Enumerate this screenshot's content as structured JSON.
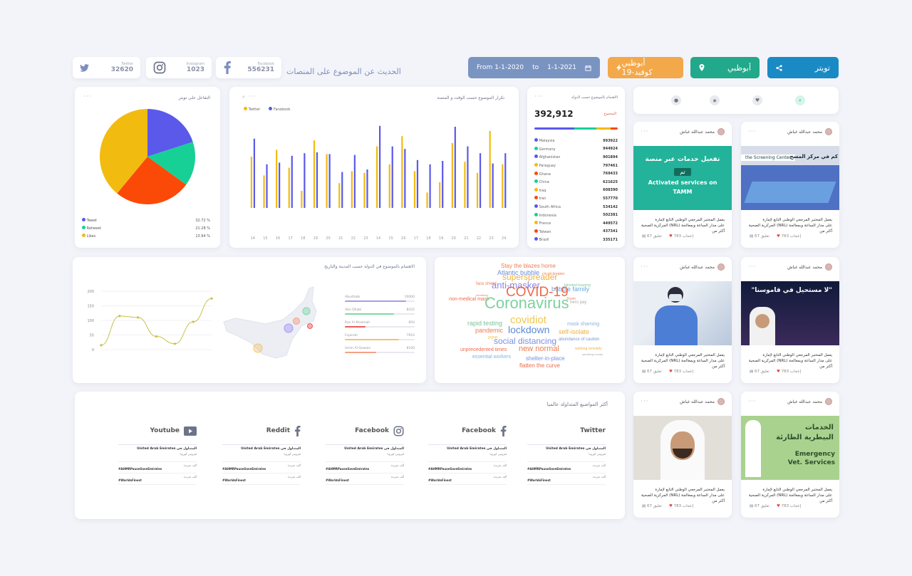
{
  "header": {
    "title": "الحديث عن الموضوع على المنصات",
    "stats": [
      {
        "label": "Twitter",
        "value": "32620",
        "icon": "twitter-icon"
      },
      {
        "label": "Instagram",
        "value": "1023",
        "icon": "instagram-icon"
      },
      {
        "label": "Facebook",
        "value": "556231",
        "icon": "facebook-icon"
      }
    ],
    "filters": {
      "from_label": "From",
      "from_date": "1-1-2020",
      "to_label": "to",
      "to_date": "1-1-2021",
      "topic": "أبوظبي كوفيد-19",
      "location": "أبوظبي",
      "platform": "تويتر"
    }
  },
  "colors": {
    "date_pill": "#7a94c2",
    "topic_pill": "#f3a84a",
    "location_pill": "#22a88a",
    "platform_pill": "#1a8ac5",
    "blue": "#5a59ea",
    "yellow": "#f2bb10",
    "green": "#17d096",
    "orange": "#fb4a08"
  },
  "pie_card": {
    "title": "التفاعل على تويتر",
    "legend": [
      {
        "label": "Tweet",
        "value": "32.72 %",
        "color": "#5a59ea"
      },
      {
        "label": "Retweet",
        "value": "21.28 %",
        "color": "#17d096"
      },
      {
        "label": "Likes",
        "value": "13.94 %",
        "color": "#f2bb10"
      }
    ]
  },
  "bar_card": {
    "title": "تكرار الموضوع حسب الوقت و المنصة",
    "legend": [
      {
        "label": "Twitter",
        "color": "#f2bb10"
      },
      {
        "label": "Facebook",
        "color": "#5a59ea"
      }
    ]
  },
  "country_card": {
    "title": "الاهتمام بالموضوع حسب الدولة",
    "total": "392,912",
    "total_label": "المجموع",
    "countries": [
      {
        "name": "Malaysia",
        "value": "993922",
        "color": "#5a59ea"
      },
      {
        "name": "Germany",
        "value": "944924",
        "color": "#17d096"
      },
      {
        "name": "Afghanistan",
        "value": "901894",
        "color": "#5a59ea"
      },
      {
        "name": "Paraguay",
        "value": "797461",
        "color": "#f2bb10"
      },
      {
        "name": "Ghana",
        "value": "769433",
        "color": "#fb4a08"
      },
      {
        "name": "China",
        "value": "621625",
        "color": "#17d096"
      },
      {
        "name": "Iraq",
        "value": "608390",
        "color": "#f2bb10"
      },
      {
        "name": "Iran",
        "value": "557770",
        "color": "#fb4a08"
      },
      {
        "name": "South Africa",
        "value": "534142",
        "color": "#5a59ea"
      },
      {
        "name": "Indonesia",
        "value": "502381",
        "color": "#17d096"
      },
      {
        "name": "France",
        "value": "449572",
        "color": "#f2bb10"
      },
      {
        "name": "Taiwan",
        "value": "437341",
        "color": "#fb4a08"
      },
      {
        "name": "Brazil",
        "value": "335171",
        "color": "#5a59ea"
      }
    ]
  },
  "map_card": {
    "title": "الاهتمام بالموضوع في الدولة حسب المدينة والتاريخ",
    "cities": [
      {
        "name": "Abudhabi",
        "value": "10000",
        "color": "#a59ef0",
        "fraction": 0.88
      },
      {
        "name": "Abu Dhabi",
        "value": "8432",
        "color": "#7fd9a6",
        "fraction": 0.7
      },
      {
        "name": "Ras Al Khaimah",
        "value": "850",
        "color": "#ee5a5a",
        "fraction": 0.3
      },
      {
        "name": "Fujairah",
        "value": "7910",
        "color": "#f3c46b",
        "fraction": 0.78
      },
      {
        "name": "Umm Al Quwain",
        "value": "8100",
        "color": "#f3a185",
        "fraction": 0.45
      }
    ]
  },
  "chart_data": [
    {
      "type": "pie",
      "labels": [
        "Tweet",
        "Retweet",
        "Likes"
      ],
      "values": [
        20,
        15,
        26,
        39
      ],
      "slice_colors": [
        "#5a59ea",
        "#17d096",
        "#fb4a08",
        "#f2bb10"
      ]
    },
    {
      "type": "bar",
      "categories": [
        "14",
        "15",
        "16",
        "17",
        "18",
        "19",
        "20",
        "21",
        "22",
        "23",
        "14",
        "15",
        "16",
        "17",
        "18",
        "19",
        "20",
        "21",
        "22",
        "23",
        "24"
      ],
      "series": [
        {
          "name": "Twitter",
          "values": [
            60,
            38,
            68,
            47,
            20,
            79,
            63,
            29,
            43,
            41,
            72,
            51,
            84,
            43,
            18,
            30,
            76,
            54,
            41,
            90,
            51
          ]
        },
        {
          "name": "Facebook",
          "values": [
            81,
            51,
            53,
            61,
            64,
            65,
            63,
            42,
            62,
            45,
            96,
            72,
            69,
            56,
            51,
            55,
            95,
            72,
            64,
            52,
            64
          ]
        }
      ],
      "ylim": [
        0,
        100
      ]
    },
    {
      "type": "line",
      "y_ticks": [
        0,
        50,
        100,
        150,
        200
      ],
      "values": [
        15,
        115,
        110,
        45,
        20,
        95,
        175
      ],
      "ylim": [
        0,
        200
      ]
    }
  ],
  "wordcloud": [
    {
      "text": "Stay the blazes home",
      "size": 8,
      "color": "#ef7d50"
    },
    {
      "text": "Atlantic bubble",
      "size": 9,
      "color": "#6a8fd9"
    },
    {
      "text": "circuit breaker",
      "size": 5,
      "color": "#ef7d50"
    },
    {
      "text": "face shield",
      "size": 6,
      "color": "#ef7d50"
    },
    {
      "text": "superspreader",
      "size": 12,
      "color": "#f2b138"
    },
    {
      "text": "blended learning",
      "size": 5,
      "color": "#7ac7a3"
    },
    {
      "text": "Infodemic",
      "size": 4,
      "color": "#ef7d50"
    },
    {
      "text": "anti-masker",
      "size": 13,
      "color": "#8a86e4"
    },
    {
      "text": "bubble family",
      "size": 9,
      "color": "#6aa7e0"
    },
    {
      "text": "Zoom",
      "size": 5,
      "color": "#ef7d50"
    },
    {
      "text": "hero pay",
      "size": 6,
      "color": "#aaa"
    },
    {
      "text": "non-medical mask",
      "size": 7,
      "color": "#ef6a4a"
    },
    {
      "text": "COVID-19",
      "size": 19,
      "color": "#ef6a4a"
    },
    {
      "text": "Coronavirus",
      "size": 22,
      "color": "#7fd0a0"
    },
    {
      "text": "rapid testing",
      "size": 9,
      "color": "#79c39a"
    },
    {
      "text": "covidiot",
      "size": 15,
      "color": "#f2c84a"
    },
    {
      "text": "mask shaming",
      "size": 7,
      "color": "#88b3df"
    },
    {
      "text": "pandemic",
      "size": 9,
      "color": "#ef7d50"
    },
    {
      "text": "self-isolate",
      "size": 9,
      "color": "#f2b138"
    },
    {
      "text": "PPE",
      "size": 7,
      "color": "#f2c84a"
    },
    {
      "text": "lockdown",
      "size": 14,
      "color": "#5a8cd6"
    },
    {
      "text": "abundance of caution",
      "size": 6,
      "color": "#7a95d6"
    },
    {
      "text": "social distancing",
      "size": 12,
      "color": "#7b8fe4"
    },
    {
      "text": "working remotely",
      "size": 5,
      "color": "#f2b138"
    },
    {
      "text": "unprecedented times",
      "size": 7,
      "color": "#ef6a4a"
    },
    {
      "text": "new normal",
      "size": 11,
      "color": "#ef7d50"
    },
    {
      "text": "speaking moody",
      "size": 4,
      "color": "#aaa"
    },
    {
      "text": "essential workers",
      "size": 7,
      "color": "#7bb4df"
    },
    {
      "text": "shelter-in-place",
      "size": 8,
      "color": "#7b8fe4"
    },
    {
      "text": "flatten the curve",
      "size": 8,
      "color": "#ef6a4a"
    }
  ],
  "trending": {
    "title": "أكثر المواضيع المتداولة عالميا",
    "columns": [
      {
        "platform": "Youtube",
        "icon": "youtube-icon"
      },
      {
        "platform": "Reddit",
        "icon": "facebook-icon"
      },
      {
        "platform": "Facebook",
        "icon": "instagram-icon"
      },
      {
        "platform": "Facebook",
        "icon": "facebook-icon"
      },
      {
        "platform": "Twitter",
        "icon": ""
      }
    ],
    "sub_label": "United Arab Emirates المتداول في",
    "rows": [
      {
        "tag": "",
        "count": "فيروس كورونا"
      },
      {
        "tag": "#AHMRPauseSaveEmirates",
        "count": "ألف تغريدة"
      },
      {
        "tag": "#WorldsFinest",
        "count": "ألف تغريدة"
      }
    ]
  },
  "search_tabs": [
    "search",
    "heart",
    "location",
    "user"
  ],
  "news": [
    {
      "author": "محمد عبدالله غباش",
      "text": "يعمل المختبر المرجعي الوطني التابع لإمارة المركزية الصحية (NRL) على مدار الساعة وبمعالجة أكثر من",
      "likes": "783 إعجاب",
      "comments": "67 تعليق",
      "image": "screening-center-photo",
      "caption": "Activated services on TAMM",
      "headline_ar": "تفعيل خدمات عبر منصة",
      "brand": "تم"
    },
    {
      "author": "محمد عبدالله غباش",
      "text": "يعمل المختبر المرجعي الوطني التابع لإمارة المركزية الصحية (NRL) على مدار الساعة وبمعالجة أكثر من",
      "likes": "783 إعجاب",
      "comments": "67 تعليق",
      "image": "tamm-banner",
      "caption": "the Screening Center",
      "headline_ar": "كم في مركز المسح",
      "brand": ""
    },
    {
      "author": "محمد عبدالله غباش",
      "text": "يعمل المختبر المرجعي الوطني التابع لإمارة المركزية الصحية (NRL) على مدار الساعة وبمعالجة أكثر من",
      "likes": "783 إعجاب",
      "comments": "67 تعليق",
      "image": "sheikh-portrait",
      "caption": "\"لا مستحيل في قاموسنا\"",
      "headline_ar": "",
      "brand": ""
    },
    {
      "author": "محمد عبدالله غباش",
      "text": "يعمل المختبر المرجعي الوطني التابع لإمارة المركزية الصحية (NRL) على مدار الساعة وبمعالجة أكثر من",
      "likes": "783 إعجاب",
      "comments": "67 تعليق",
      "image": "lab-worker-photo",
      "caption": "",
      "headline_ar": "",
      "brand": ""
    },
    {
      "author": "محمد عبدالله غباش",
      "text": "يعمل المختبر المرجعي الوطني التابع لإمارة المركزية الصحية (NRL) على مدار الساعة وبمعالجة أكثر من",
      "likes": "783 إعجاب",
      "comments": "67 تعليق",
      "image": "vet-services-banner",
      "caption": "Emergency Vet. Services",
      "headline_ar": "الخدمات البيطرية الطارئة",
      "brand": ""
    },
    {
      "author": "محمد عبدالله غباش",
      "text": "يعمل المختبر المرجعي الوطني التابع لإمارة المركزية الصحية (NRL) على مدار الساعة وبمعالجة أكثر من",
      "likes": "783 إعجاب",
      "comments": "67 تعليق",
      "image": "man-portrait",
      "caption": "",
      "headline_ar": "",
      "brand": ""
    }
  ]
}
